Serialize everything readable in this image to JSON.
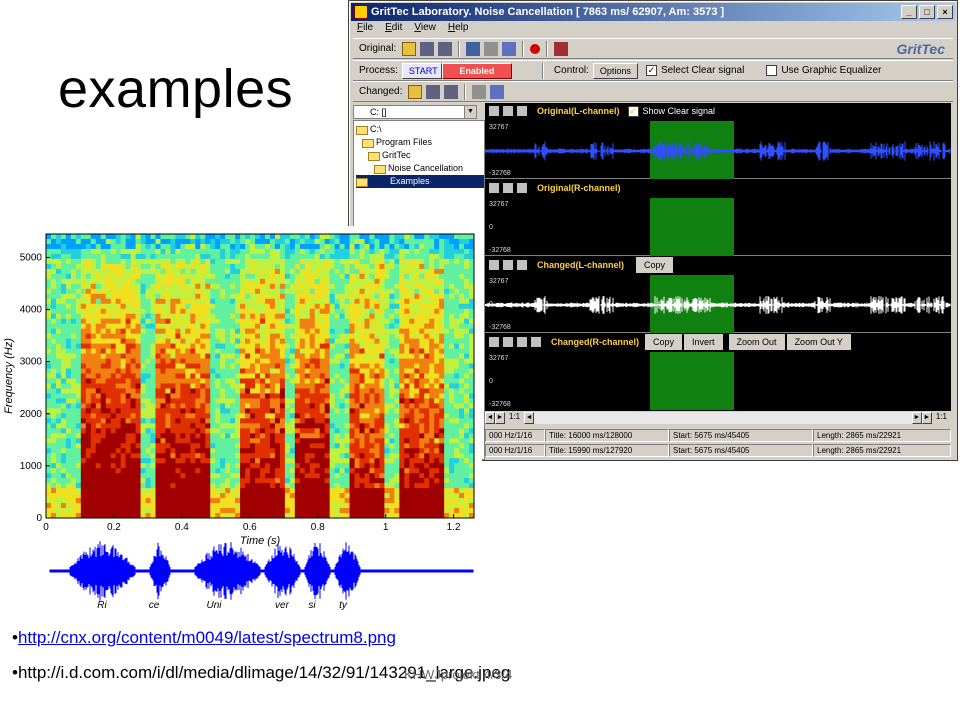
{
  "slide": {
    "title": "examples",
    "bullets": [
      {
        "text": "http://cnx.org/content/m0049/latest/spectrum8.png",
        "link": true
      },
      {
        "text": "http://i.d.com.com/i/dl/media/dlimage/14/32/91/143291_large.jpeg",
        "link": false
      }
    ],
    "footer": "KHWJprojekt 4/3/4"
  },
  "window": {
    "title": "GritTec Laboratory. Noise Cancellation [ 7863 ms/ 62907, Am:  3573 ]",
    "controls": {
      "minimize": "_",
      "maximize": "□",
      "close": "×"
    },
    "menu": [
      "File",
      "Edit",
      "View",
      "Help"
    ],
    "toolbar1": {
      "label": "Original:",
      "logo": "GritTec"
    },
    "toolbar2": {
      "label": "Process:",
      "start": "START",
      "enabled": "Enabled",
      "control_label": "Control:",
      "options": "Options",
      "select_clear": "Select Clear signal",
      "select_clear_checked": true,
      "graphic_eq": "Use Graphic Equalizer",
      "graphic_eq_checked": false
    },
    "toolbar3": {
      "label": "Changed:"
    },
    "drive": "C: []",
    "tree": [
      {
        "label": "C:\\",
        "indent": 0,
        "selected": false
      },
      {
        "label": "Program Files",
        "indent": 1,
        "selected": false
      },
      {
        "label": "GritTec",
        "indent": 2,
        "selected": false
      },
      {
        "label": "Noise Cancellation",
        "indent": 3,
        "selected": false
      },
      {
        "label": "Examples",
        "indent": 4,
        "selected": true
      }
    ],
    "tracks": [
      {
        "name": "Original(L-channel)",
        "extra_label": "Show Clear signal",
        "buttons": [],
        "max": "32767",
        "zero": "",
        "min": "-32768"
      },
      {
        "name": "Original(R-channel)",
        "extra_label": "",
        "buttons": [],
        "max": "32767",
        "zero": "0",
        "min": "-32768"
      },
      {
        "name": "Changed(L-channel)",
        "extra_label": "",
        "buttons": [
          "Copy"
        ],
        "max": "32767",
        "zero": "0",
        "min": "-32768"
      },
      {
        "name": "Changed(R-channel)",
        "extra_label": "",
        "buttons": [
          "Copy",
          "Invert",
          "Zoom Out",
          "Zoom Out Y"
        ],
        "max": "32767",
        "zero": "0",
        "min": "-32768"
      }
    ],
    "scroll": {
      "left_ratio": "1:1",
      "right_ratio": "1:1"
    },
    "status_rows": [
      {
        "rate": "000 Hz/1/16",
        "title": "Title: 16000 ms/128000",
        "start": "Start: 5675 ms/45405",
        "length": "Length: 2865 ms/22921"
      },
      {
        "rate": "000 Hz/1/16",
        "title": "Title: 15990 ms/127920",
        "start": "Start: 5675 ms/45405",
        "length": "Length: 2865 ms/22921"
      }
    ]
  },
  "spectrogram": {
    "ylabel": "Frequency (Hz)",
    "xlabel": "Time (s)",
    "yticks": [
      "0",
      "1000",
      "2000",
      "3000",
      "4000",
      "5000"
    ],
    "xticks": [
      "0",
      "0.2",
      "0.4",
      "0.6",
      "0.8",
      "1",
      "1.2"
    ],
    "syllables": [
      "Ri",
      "ce",
      "Uni",
      "ver",
      "si",
      "ty"
    ]
  }
}
